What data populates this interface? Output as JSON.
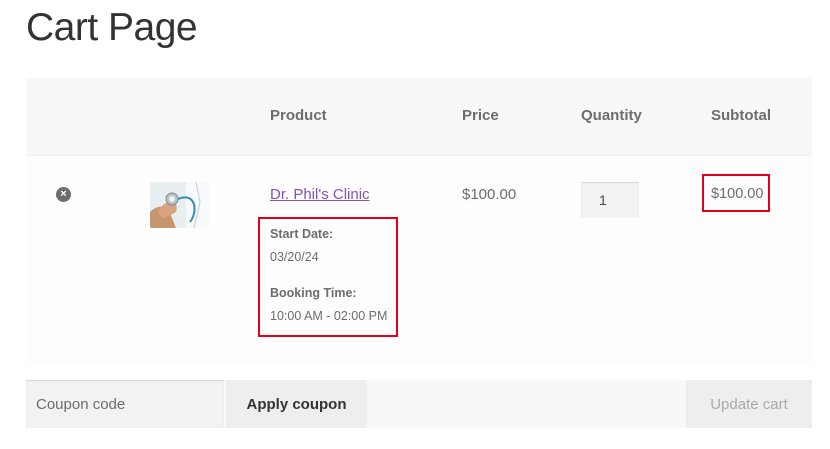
{
  "page": {
    "title": "Cart Page"
  },
  "table": {
    "headers": {
      "product": "Product",
      "price": "Price",
      "quantity": "Quantity",
      "subtotal": "Subtotal"
    }
  },
  "cart_item": {
    "remove_symbol": "×",
    "image_alt": "doctor-stethoscope-thumbnail",
    "product_name": "Dr. Phil's Clinic",
    "meta": {
      "start_date_label": "Start Date:",
      "start_date_value": "03/20/24",
      "booking_time_label": "Booking Time:",
      "booking_time_value": "10:00 AM - 02:00 PM"
    },
    "price": "$100.00",
    "quantity": "1",
    "subtotal": "$100.00"
  },
  "actions": {
    "coupon_placeholder": "Coupon code",
    "apply_label": "Apply coupon",
    "update_label": "Update cart"
  },
  "colors": {
    "link": "#7f54b3",
    "highlight": "#e5001a"
  }
}
